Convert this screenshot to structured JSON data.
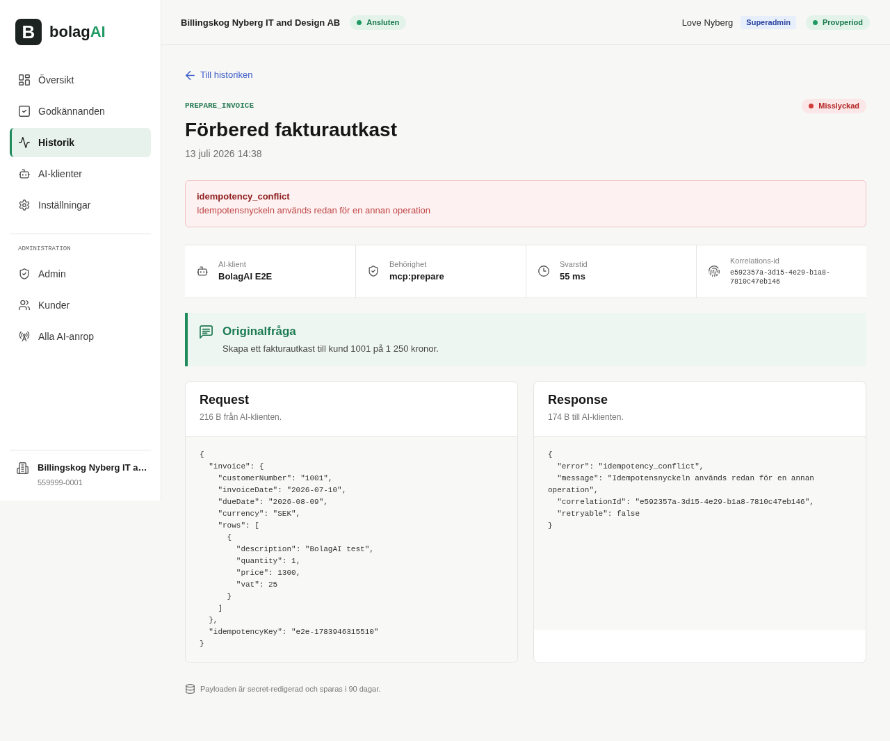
{
  "sidebar": {
    "logo": {
      "mark": "B",
      "name": "bolag",
      "accent": "AI"
    },
    "nav": [
      {
        "label": "Översikt",
        "selected": false
      },
      {
        "label": "Godkännanden",
        "selected": false
      },
      {
        "label": "Historik",
        "selected": true
      },
      {
        "label": "AI-klienter",
        "selected": false
      },
      {
        "label": "Inställningar",
        "selected": false
      }
    ],
    "sections": [
      {
        "heading": "ADMINISTRATION",
        "items": [
          {
            "label": "Admin",
            "selected": false
          },
          {
            "label": "Kunder",
            "selected": false
          },
          {
            "label": "Alla AI-anrop",
            "selected": false
          }
        ]
      }
    ],
    "organization": {
      "name": "Billingskog Nyberg IT a…",
      "number": "559999-0001"
    }
  },
  "header": {
    "company": "Billingskog Nyberg IT and Design AB",
    "connection": {
      "label": "Ansluten",
      "kind": "success"
    },
    "user": "Love Nyberg",
    "role": {
      "label": "Superadmin",
      "kind": "info"
    },
    "plan": {
      "label": "Provperiod",
      "kind": "success"
    }
  },
  "run": {
    "back_link": "Till historiken",
    "operation": "PREPARE_INVOICE",
    "status": {
      "label": "Misslyckad",
      "kind": "danger"
    },
    "title": "Förbered fakturautkast",
    "timestamp": "13 juli 2026 14:38",
    "error": {
      "code": "idempotency_conflict",
      "message": "Idempotensnyckeln används redan för en annan operation"
    },
    "details": [
      {
        "label": "AI-klient",
        "value": "BolagAI E2E",
        "kind": "text"
      },
      {
        "label": "Behörighet",
        "value": "mcp:prepare",
        "kind": "text"
      },
      {
        "label": "Svarstid",
        "value": "55 ms",
        "kind": "text"
      },
      {
        "label": "Korrelations-id",
        "value": "e592357a-3d15-4e29-b1a8-7810c47eb146",
        "kind": "code"
      }
    ],
    "original_question": {
      "title": "Originalfråga",
      "text": "Skapa ett fakturautkast till kund 1001 på 1 250 kronor."
    },
    "payloads": [
      {
        "title": "Request",
        "subtitle": "216 B från AI-klienten.",
        "code": "{\n  \"invoice\": {\n    \"customerNumber\": \"1001\",\n    \"invoiceDate\": \"2026-07-10\",\n    \"dueDate\": \"2026-08-09\",\n    \"currency\": \"SEK\",\n    \"rows\": [\n      {\n        \"description\": \"BolagAI test\",\n        \"quantity\": 1,\n        \"price\": 1300,\n        \"vat\": 25\n      }\n    ]\n  },\n  \"idempotencyKey\": \"e2e-1783946315510\"\n}"
      },
      {
        "title": "Response",
        "subtitle": "174 B till AI-klienten.",
        "code": "{\n  \"error\": \"idempotency_conflict\",\n  \"message\": \"Idempotensnyckeln används redan för en annan operation\",\n  \"correlationId\": \"e592357a-3d15-4e29-b1a8-7810c47eb146\",\n  \"retryable\": false\n}"
      }
    ],
    "footer_note": "Payloaden är secret-redigerad och sparas i 90 dagar."
  }
}
